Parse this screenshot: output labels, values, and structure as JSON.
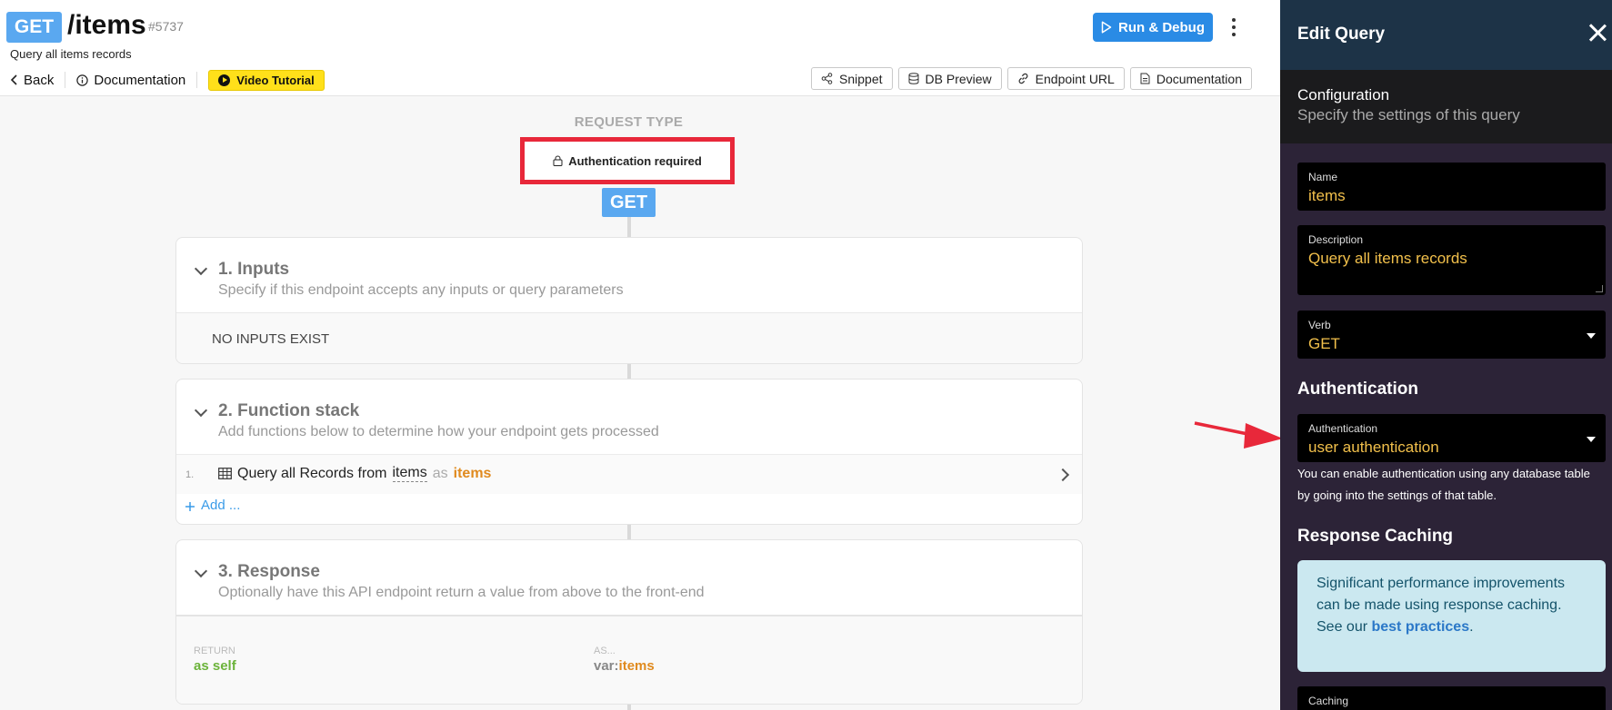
{
  "header": {
    "verb": "GET",
    "endpoint": "/items",
    "id": "#5737",
    "description": "Query all items records",
    "nav": {
      "back": "Back",
      "documentation": "Documentation",
      "video": "Video Tutorial"
    },
    "run_debug": "Run & Debug",
    "toolbar": [
      "Snippet",
      "DB Preview",
      "Endpoint URL",
      "Documentation"
    ]
  },
  "request": {
    "label": "REQUEST TYPE",
    "auth_required": "Authentication required",
    "verb": "GET"
  },
  "inputs": {
    "title": "1. Inputs",
    "subtitle": "Specify if this endpoint accepts any inputs or query parameters",
    "empty": "NO INPUTS EXIST"
  },
  "function_stack": {
    "title": "2. Function stack",
    "subtitle": "Add functions below to determine how your endpoint gets processed",
    "items": [
      {
        "num": "1.",
        "text": "Query all Records from",
        "table": "items",
        "as": "as",
        "var": "items"
      }
    ],
    "add": "Add ..."
  },
  "response": {
    "title": "3. Response",
    "subtitle": "Optionally have this API endpoint return a value from above to the front-end",
    "return_label": "RETURN",
    "return_value": "as self",
    "as_label": "AS...",
    "as_prefix": "var:",
    "as_value": "items"
  },
  "panel": {
    "title": "Edit Query",
    "config_title": "Configuration",
    "config_sub": "Specify the settings of this query",
    "name_label": "Name",
    "name_value": "items",
    "desc_label": "Description",
    "desc_value": "Query all items records",
    "verb_label": "Verb",
    "verb_value": "GET",
    "auth_heading": "Authentication",
    "auth_label": "Authentication",
    "auth_value": "user authentication",
    "auth_help": "You can enable authentication using any database table by going into the settings of that table.",
    "caching_heading": "Response Caching",
    "caching_info_pre": "Significant performance improvements can be made using response caching. See our ",
    "caching_info_link": "best practices",
    "caching_info_post": ".",
    "caching_label": "Caching"
  },
  "colors": {
    "accent_blue": "#2a8be5",
    "verb_badge": "#5aa8f0",
    "highlight_red": "#e8283a",
    "var_orange": "#e08a1e",
    "field_text": "#f2c04b",
    "panel_bg": "#2c2337"
  }
}
